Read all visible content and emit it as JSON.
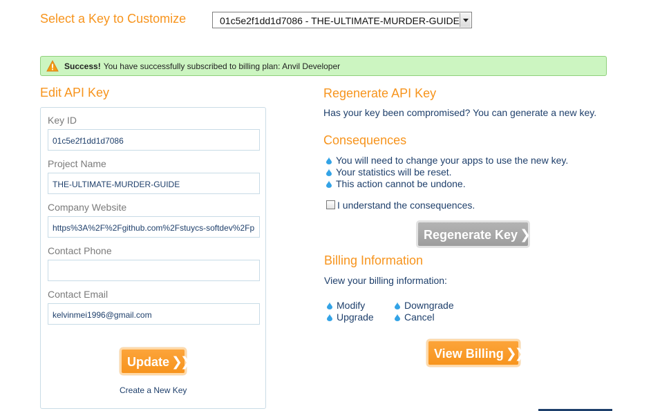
{
  "header": {
    "select_title": "Select a Key to Customize",
    "selected_key": "01c5e2f1dd1d7086 - THE-ULTIMATE-MURDER-GUIDE"
  },
  "banner": {
    "strong": "Success!",
    "message": "You have successfully subscribed to billing plan: Anvil Developer"
  },
  "edit": {
    "title": "Edit API Key",
    "fields": [
      {
        "label": "Key ID",
        "value": "01c5e2f1dd1d7086"
      },
      {
        "label": "Project Name",
        "value": "THE-ULTIMATE-MURDER-GUIDE"
      },
      {
        "label": "Company Website",
        "value": "https%3A%2F%2Fgithub.com%2Fstuycs-softdev%2Fp"
      },
      {
        "label": "Contact Phone",
        "value": ""
      },
      {
        "label": "Contact Email",
        "value": "kelvinmei1996@gmail.com"
      }
    ],
    "update_label": "Update",
    "create_link": "Create a New Key"
  },
  "regenerate": {
    "title": "Regenerate API Key",
    "description": "Has your key been compromised? You can generate a new key.",
    "consequences_title": "Consequences",
    "consequences": [
      "You will need to change your apps to use the new key.",
      "Your statistics will be reset.",
      "This action cannot be undone."
    ],
    "checkbox_label": "I understand the consequences.",
    "button_label": "Regenerate Key"
  },
  "billing": {
    "title": "Billing Information",
    "description": "View your billing information:",
    "links": [
      "Modify",
      "Upgrade",
      "Downgrade",
      "Cancel"
    ],
    "button_label": "View Billing"
  },
  "colors": {
    "accent_orange": "#f7941d",
    "link_blue": "#1e3f6b",
    "success_bg": "#ccf5c1"
  },
  "icons": [
    "warning-icon",
    "drop-bullet-icon",
    "chevron-right-icon",
    "chevron-down-icon"
  ]
}
